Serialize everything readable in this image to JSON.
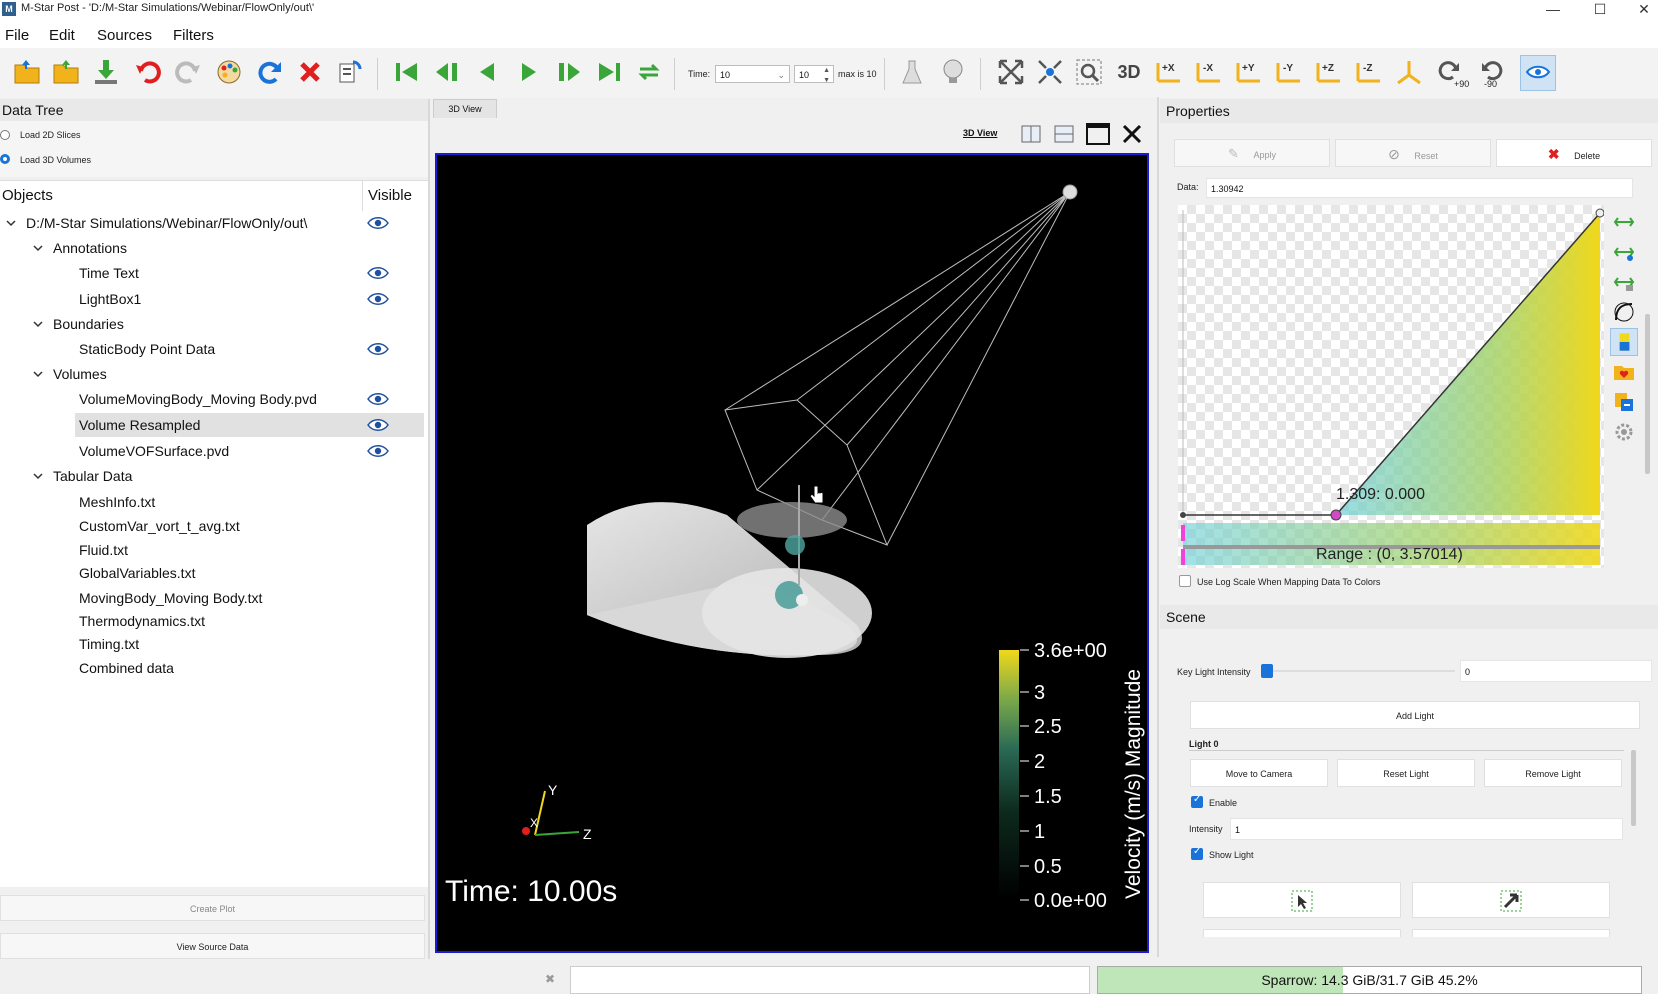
{
  "window": {
    "title": "M-Star Post - 'D:/M-Star Simulations/Webinar/FlowOnly/out\\'",
    "logo_text": "M",
    "minimize": "—",
    "maximize": "☐",
    "close": "✕"
  },
  "menu": [
    "File",
    "Edit",
    "Sources",
    "Filters"
  ],
  "toolbar": {
    "time_label": "Time:",
    "time_value": "10",
    "step_value": "10",
    "max_label": "max is 10",
    "view_3d_label": "3D",
    "axis_buttons": [
      "+X",
      "-X",
      "+Y",
      "-Y",
      "+Z",
      "-Z"
    ],
    "rotate_pos": "+90",
    "rotate_neg": "-90",
    "colors": {
      "accent": "#1a73d9",
      "danger": "#e02020",
      "folder": "#f2b21b",
      "nav": "#3aa63a"
    }
  },
  "data_tree": {
    "title": "Data Tree",
    "load_options": [
      {
        "label": "Load 2D Slices",
        "selected": false
      },
      {
        "label": "Load 3D Volumes",
        "selected": true
      }
    ],
    "col_objects": "Objects",
    "col_visible": "Visible",
    "items": [
      {
        "label": "D:/M-Star Simulations/Webinar/FlowOnly/out\\",
        "level": 0,
        "expand": true,
        "visible": true,
        "selected": false
      },
      {
        "label": "Annotations",
        "level": 1,
        "expand": true,
        "visible": false,
        "selected": false
      },
      {
        "label": "Time Text",
        "level": 2,
        "expand": false,
        "visible": true,
        "selected": false
      },
      {
        "label": "LightBox1",
        "level": 2,
        "expand": false,
        "visible": true,
        "selected": false
      },
      {
        "label": "Boundaries",
        "level": 1,
        "expand": true,
        "visible": false,
        "selected": false
      },
      {
        "label": "StaticBody Point Data",
        "level": 2,
        "expand": false,
        "visible": true,
        "selected": false
      },
      {
        "label": "Volumes",
        "level": 1,
        "expand": true,
        "visible": false,
        "selected": false
      },
      {
        "label": "VolumeMovingBody_Moving Body.pvd",
        "level": 2,
        "expand": false,
        "visible": true,
        "selected": false
      },
      {
        "label": "Volume Resampled",
        "level": 2,
        "expand": false,
        "visible": true,
        "selected": true
      },
      {
        "label": "VolumeVOFSurface.pvd",
        "level": 2,
        "expand": false,
        "visible": true,
        "selected": false
      },
      {
        "label": "Tabular Data",
        "level": 1,
        "expand": true,
        "visible": false,
        "selected": false
      },
      {
        "label": "MeshInfo.txt",
        "level": 2,
        "expand": false,
        "visible": false,
        "selected": false
      },
      {
        "label": "CustomVar_vort_t_avg.txt",
        "level": 2,
        "expand": false,
        "visible": false,
        "selected": false
      },
      {
        "label": "Fluid.txt",
        "level": 2,
        "expand": false,
        "visible": false,
        "selected": false
      },
      {
        "label": "GlobalVariables.txt",
        "level": 2,
        "expand": false,
        "visible": false,
        "selected": false
      },
      {
        "label": "MovingBody_Moving Body.txt",
        "level": 2,
        "expand": false,
        "visible": false,
        "selected": false
      },
      {
        "label": "Thermodynamics.txt",
        "level": 2,
        "expand": false,
        "visible": false,
        "selected": false
      },
      {
        "label": "Timing.txt",
        "level": 2,
        "expand": false,
        "visible": false,
        "selected": false
      },
      {
        "label": "Combined data",
        "level": 2,
        "expand": false,
        "visible": false,
        "selected": false
      }
    ],
    "create_plot": "Create Plot",
    "view_source_data": "View Source Data"
  },
  "view": {
    "tab_label": "3D View",
    "view_link": "3D View",
    "time_text": "Time: 10.00s",
    "colorbar_title": "Velocity (m/s) Magnitude",
    "colorbar_ticks": [
      "3.6e+00",
      "3",
      "2.5",
      "2",
      "1.5",
      "1",
      "0.5",
      "0.0e+00"
    ],
    "axis_labels": {
      "x": "X",
      "y": "Y",
      "z": "Z"
    }
  },
  "properties": {
    "title": "Properties",
    "apply": "Apply",
    "reset": "Reset",
    "delete": "Delete",
    "data_label": "Data:",
    "data_value": "1.30942",
    "point_label": "1.309: 0.000",
    "range_label": "Range : (0, 3.57014)",
    "log_scale_label": "Use Log Scale When Mapping Data To Colors"
  },
  "scene": {
    "title": "Scene",
    "key_light_label": "Key Light Intensity",
    "key_light_value": "0",
    "add_light": "Add Light",
    "light0_label": "Light 0",
    "move_to_camera": "Move to Camera",
    "reset_light": "Reset Light",
    "remove_light": "Remove Light",
    "enable_label": "Enable",
    "intensity_label": "Intensity",
    "intensity_value": "1",
    "show_light_label": "Show Light"
  },
  "status": {
    "memory_text": "Sparrow: 14.3 GiB/31.7 GiB 45.2%",
    "memory_fraction": 0.452,
    "close_glyph": "✖"
  }
}
